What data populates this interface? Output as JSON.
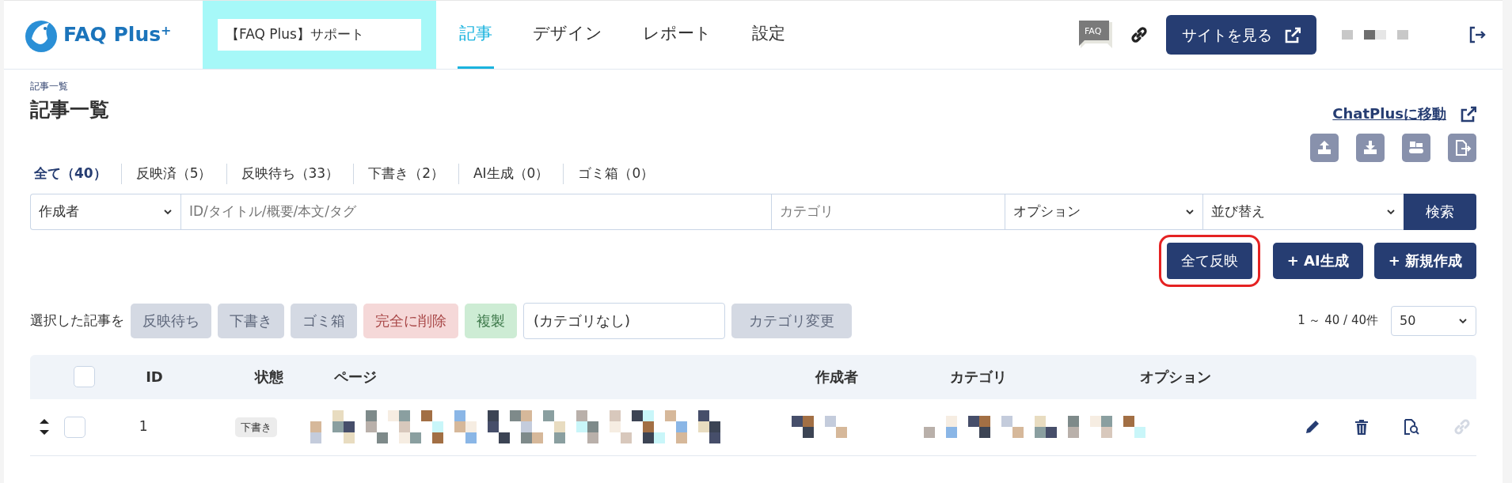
{
  "logo": {
    "text": "FAQ Plus",
    "sup": "+"
  },
  "site_select": {
    "value": "【FAQ Plus】サポート"
  },
  "nav": [
    {
      "label": "記事",
      "selected": true
    },
    {
      "label": "デザイン",
      "selected": false
    },
    {
      "label": "レポート",
      "selected": false
    },
    {
      "label": "設定",
      "selected": false
    }
  ],
  "header": {
    "faq_badge": "FAQ",
    "view_site_button": "サイトを見る"
  },
  "breadcrumb": "記事一覧",
  "title": "記事一覧",
  "chatplus_link": "ChatPlusに移動",
  "status_tabs": [
    {
      "label": "全て（40）",
      "selected": true
    },
    {
      "label": "反映済（5）",
      "selected": false
    },
    {
      "label": "反映待ち（33）",
      "selected": false
    },
    {
      "label": "下書き（2）",
      "selected": false
    },
    {
      "label": "AI生成（0）",
      "selected": false
    },
    {
      "label": "ゴミ箱（0）",
      "selected": false
    }
  ],
  "filters": [
    {
      "kind": "select",
      "value": "作成者"
    },
    {
      "kind": "input",
      "placeholder": "ID/タイトル/概要/本文/タグ"
    },
    {
      "kind": "input",
      "placeholder": "カテゴリ"
    },
    {
      "kind": "select",
      "value": "オプション"
    },
    {
      "kind": "select",
      "value": "並び替え"
    }
  ],
  "search_button": "検索",
  "actions": [
    {
      "label": "全て反映",
      "highlighted": true
    },
    {
      "label": "AI生成",
      "prefix": "+",
      "highlighted": false
    },
    {
      "label": "新規作成",
      "prefix": "+",
      "highlighted": false
    }
  ],
  "bulk": {
    "label": "選択した記事を",
    "buttons": [
      {
        "label": "反映待ち",
        "kind": "move",
        "disabled": true
      },
      {
        "label": "下書き",
        "kind": "move",
        "disabled": true
      },
      {
        "label": "ゴミ箱",
        "kind": "move",
        "disabled": true
      },
      {
        "label": "完全に削除",
        "kind": "delete",
        "disabled": true
      },
      {
        "label": "複製",
        "kind": "copy",
        "disabled": true
      }
    ],
    "category_select": "(カテゴリなし)",
    "category_button": {
      "label": "カテゴリ変更",
      "disabled": true
    }
  },
  "pagination": {
    "range": "1 ～ 40 / 40件",
    "per_page": "50"
  },
  "table": {
    "select_all_checked": false,
    "columns": [
      "ID",
      "状態",
      "ページ",
      "作成者",
      "カテゴリ",
      "オプション"
    ],
    "rows": [
      {
        "checked": false,
        "id": "1",
        "status": "下書き"
      }
    ]
  }
}
